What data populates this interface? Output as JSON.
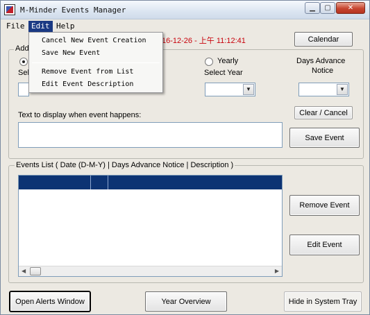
{
  "window": {
    "title": "M-Minder Events Manager",
    "controls": {
      "minimize": "▁",
      "maximize": "▢",
      "close": "✕"
    }
  },
  "menubar": {
    "file": "File",
    "edit": "Edit",
    "help": "Help"
  },
  "edit_menu": {
    "items": [
      "Cancel New Event Creation",
      "Save New Event",
      "Remove Event from List",
      "Edit Event Description"
    ]
  },
  "datetime": "16-12-26 - 上午 11:12:41",
  "buttons": {
    "calendar": "Calendar",
    "clear_cancel": "Clear / Cancel",
    "save_event": "Save Event",
    "remove_event": "Remove Event",
    "edit_event": "Edit Event",
    "open_alerts": "Open Alerts Window",
    "year_overview": "Year Overview",
    "hide_tray": "Hide in System Tray"
  },
  "add_group": {
    "label_partial": "Add",
    "select_partial": "Sel",
    "yearly_label": "Yearly",
    "select_year_label": "Select Year",
    "days_advance_label_line1": "Days Advance",
    "days_advance_label_line2": "Notice",
    "text_label": "Text to display when event happens:"
  },
  "events_group": {
    "label": "Events List   ( Date (D-M-Y)  |  Days Advance Notice  |  Description )"
  },
  "icons": {
    "scroll_left": "◀",
    "scroll_right": "▶",
    "combo_arrow": "▼"
  }
}
